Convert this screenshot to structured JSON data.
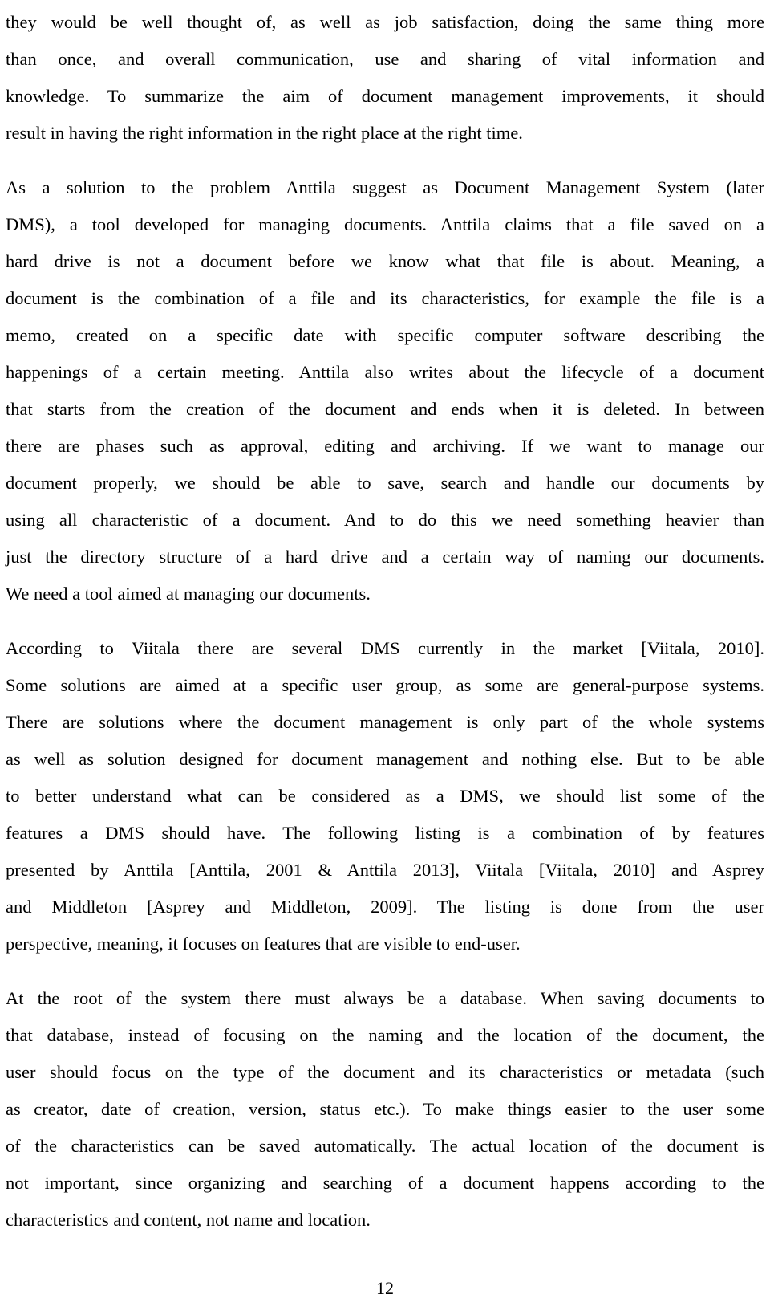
{
  "document": {
    "paragraphs": [
      {
        "lines": [
          "they would be well thought of, as well as job satisfaction, doing the same thing more",
          "than once, and overall communication, use and sharing of vital information and",
          "knowledge. To summarize the aim of document management improvements, it should",
          "result in having the right information in the right place at the right time."
        ]
      },
      {
        "lines": [
          "As a solution to the problem Anttila suggest as Document Management System (later",
          "DMS), a tool developed for managing documents. Anttila claims that a file saved on a",
          "hard drive is not a document before we know what that file is about. Meaning, a",
          "document is the combination of a file and its characteristics, for example the file is a",
          "memo, created on a specific date with specific computer software describing the",
          "happenings of a certain meeting. Anttila also writes about the lifecycle of a document",
          "that starts from the creation of the document and ends when it is deleted. In between",
          "there are phases such as approval, editing and archiving. If we want to manage our",
          "document properly, we should be able to save, search and handle our documents by",
          "using all characteristic of a document. And to do this we need something heavier than",
          "just the directory structure of a hard drive and a certain way of naming our documents.",
          "We need a tool aimed at managing our documents."
        ]
      },
      {
        "lines": [
          "According to Viitala there are several DMS currently in the market [Viitala, 2010].",
          "Some solutions are aimed at a specific user group, as some are general-purpose systems.",
          "There are solutions where the document management is only part of the whole systems",
          "as well as solution designed for document management and nothing else. But to be able",
          "to better understand what can be considered as a DMS, we should list some of the",
          "features a DMS should have. The following listing is a combination of by features",
          "presented by Anttila [Anttila, 2001 & Anttila 2013], Viitala [Viitala, 2010] and Asprey",
          "and Middleton [Asprey and Middleton, 2009]. The listing is done from the user",
          "perspective, meaning, it focuses on features that are visible to end-user."
        ]
      },
      {
        "lines": [
          "At the root of the system there must always be a database. When saving documents to",
          "that database, instead of focusing on the naming and the location of the document, the",
          "user should focus on the type of the document and its characteristics or metadata (such",
          "as creator, date of creation, version, status etc.). To make things easier to the user some",
          "of the characteristics can be saved automatically. The actual location of the document is",
          "not important, since organizing and searching of a document happens according to the",
          "characteristics and content, not name and location."
        ]
      }
    ],
    "page_number": "12"
  }
}
